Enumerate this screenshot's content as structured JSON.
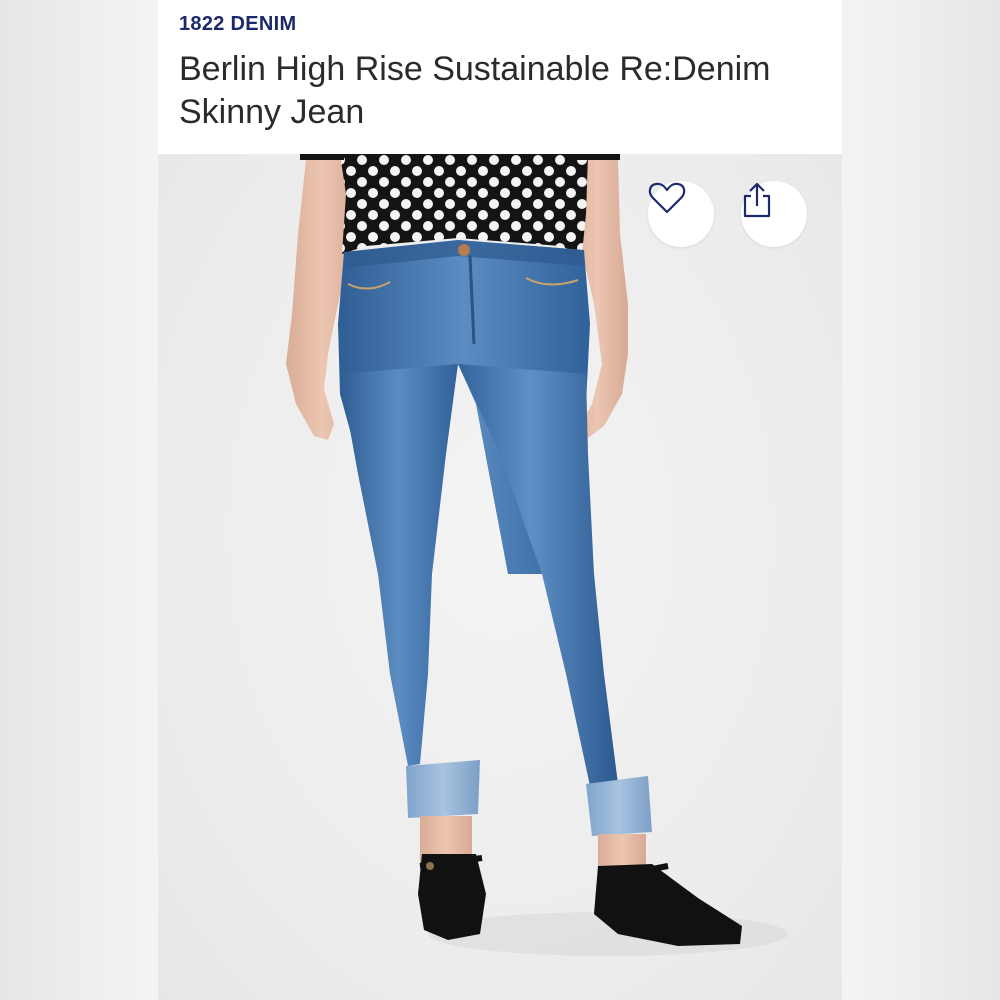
{
  "product": {
    "brand": "1822 DENIM",
    "title": "Berlin High Rise Sustainable Re:Denim Skinny Jean"
  },
  "actions": {
    "favorite_icon": "heart-icon",
    "share_icon": "share-icon"
  },
  "colors": {
    "brand_text": "#1c2a6b",
    "title_text": "#2b2b2b",
    "denim": "#3f6fa6",
    "icon": "#1c2a6b"
  }
}
